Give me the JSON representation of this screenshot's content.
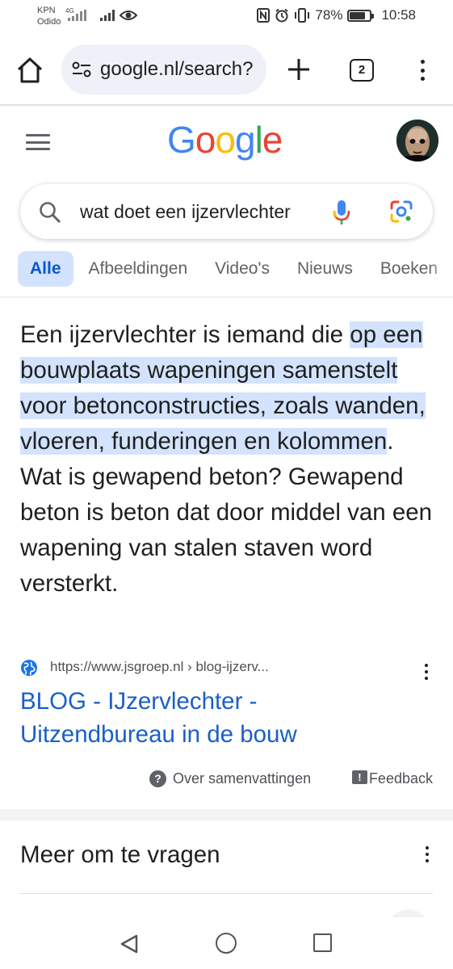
{
  "status_bar": {
    "carrier_1": "KPN",
    "carrier_2": "Odido",
    "network_type": "4G",
    "battery": "78%",
    "battery_level": 0.78,
    "time": "10:58",
    "icons": [
      "nfc-icon",
      "alarm-icon",
      "vibrate-icon",
      "battery-icon",
      "signal-icon",
      "eye-icon"
    ]
  },
  "browser": {
    "url": "google.nl/search?",
    "tab_count": "2",
    "icons": [
      "home-icon",
      "tune-icon",
      "plus-icon",
      "tabs-icon",
      "overflow-menu-icon"
    ]
  },
  "google": {
    "logo_letters": [
      {
        "char": "G",
        "color": "#4285F4"
      },
      {
        "char": "o",
        "color": "#EA4335"
      },
      {
        "char": "o",
        "color": "#FBBC05"
      },
      {
        "char": "g",
        "color": "#4285F4"
      },
      {
        "char": "l",
        "color": "#34A853"
      },
      {
        "char": "e",
        "color": "#EA4335"
      }
    ]
  },
  "search": {
    "query": "wat doet een ijzervlechter"
  },
  "filters": [
    {
      "label": "Alle",
      "active": true
    },
    {
      "label": "Afbeeldingen",
      "active": false
    },
    {
      "label": "Video's",
      "active": false
    },
    {
      "label": "Nieuws",
      "active": false
    },
    {
      "label": "Boeken",
      "active": false
    }
  ],
  "answer": {
    "lead": "Een ijzervlechter is iemand die ",
    "highlight": "op een bouwplaats wapeningen samenstelt voor betonconstructies, zoals wanden, vloeren, funderingen en kolommen",
    "tail": ". Wat is gewapend beton? Gewapend beton is beton dat door middel van een wapening van stalen staven word versterkt."
  },
  "source": {
    "url": "https://www.jsgroep.nl › blog-ijzerv...",
    "title": "BLOG - IJzervlechter - Uitzendbureau in de bouw"
  },
  "feedback_row": {
    "about": "Over samenvattingen",
    "feedback": "Feedback"
  },
  "people_also_ask": {
    "title": "Meer om te vragen"
  },
  "colors": {
    "highlight": "#d3e3fd",
    "link": "#1a5fc8",
    "chip_active_bg": "#d3e3fd",
    "chip_active_text": "#0b57d0"
  }
}
